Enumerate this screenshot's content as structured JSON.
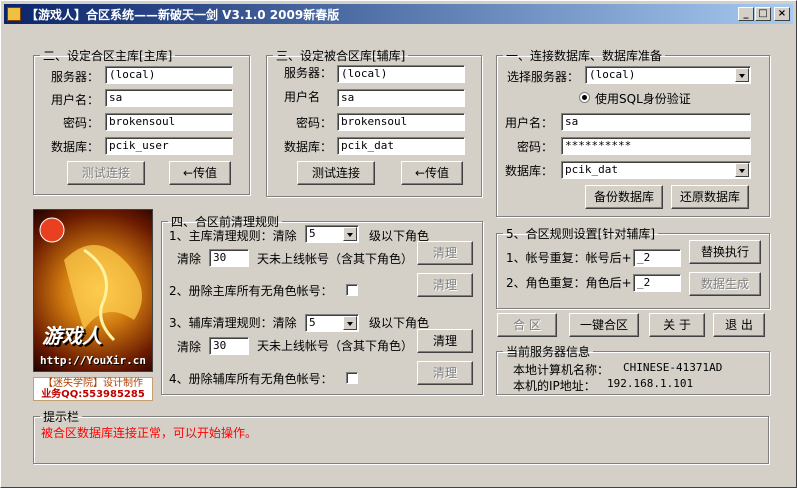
{
  "window": {
    "title": "【游戏人】合区系统——新破天一剑 V3.1.0 2009新春版"
  },
  "main_db": {
    "legend": "二、设定合区主库[主库]",
    "server_label": "服务器：",
    "server_value": "(local)",
    "user_label": "用户名：",
    "user_value": "sa",
    "pass_label": "密码：",
    "pass_value": "brokensoul",
    "db_label": "数据库：",
    "db_value": "pcik_user",
    "test_btn": "测试连接",
    "pass_btn": "←传值"
  },
  "aux_db": {
    "legend": "三、设定被合区库[辅库]",
    "server_label": "服务器：",
    "server_value": "(local)",
    "user_label": "用户名",
    "user_value": "sa",
    "pass_label": "密码：",
    "pass_value": "brokensoul",
    "db_label": "数据库：",
    "db_value": "pcik_dat",
    "test_btn": "测试连接",
    "pass_btn": "←传值"
  },
  "connect": {
    "legend": "一、连接数据库、数据库准备",
    "server_label": "选择服务器：",
    "server_value": "(local)",
    "auth_label": "使用SQL身份验证",
    "user_label": "用户名：",
    "user_value": "sa",
    "pass_label": "密码：",
    "pass_value": "**********",
    "db_label": "数据库：",
    "db_value": "pcik_dat",
    "backup_btn": "备份数据库",
    "restore_btn": "还原数据库"
  },
  "cleanup": {
    "legend": "四、合区前清理规则",
    "rule1_label": "1、主库清理规则：清除",
    "rule1_level": "5",
    "rule1_suffix": "级以下角色",
    "rule1_clear": "清除",
    "rule1_days": "30",
    "rule1_days_suffix": "天未上线帐号（含其下角色）",
    "rule1_btn": "清理",
    "rule2_label": "2、册除主库所有无角色帐号：",
    "rule2_btn": "清理",
    "rule3_label": "3、辅库清理规则：清除",
    "rule3_level": "5",
    "rule3_suffix": "级以下角色",
    "rule3_clear": "清除",
    "rule3_days": "30",
    "rule3_days_suffix": "天未上线帐号（含其下角色）",
    "rule3_btn": "清理",
    "rule4_label": "4、册除辅库所有无角色帐号：",
    "rule4_btn": "清理"
  },
  "merge_rules": {
    "legend": "5、合区规则设置[针对辅库]",
    "dup_account_label": "1、帐号重复：帐号后+",
    "dup_account_value": "_2",
    "dup_role_label": "2、角色重复：角色后+",
    "dup_role_value": "_2",
    "replace_btn": "替换执行",
    "generate_btn": "数据生成"
  },
  "actions": {
    "merge": "合 区",
    "one_click": "一键合区",
    "about": "关 于",
    "exit": "退 出"
  },
  "server_info": {
    "legend": "当前服务器信息",
    "computer_label": "本地计算机名称：",
    "computer_value": "CHINESE-41371AD",
    "ip_label": "本机的IP地址：",
    "ip_value": "192.168.1.101"
  },
  "logo": {
    "chinese": "游戏人",
    "url": "http://YouXir.cn"
  },
  "badge": {
    "line1": "【迷失学院】设计制作",
    "line2": "业务QQ:553985285"
  },
  "hint": {
    "legend": "提示栏",
    "message": "被合区数据库连接正常，可以开始操作。"
  }
}
